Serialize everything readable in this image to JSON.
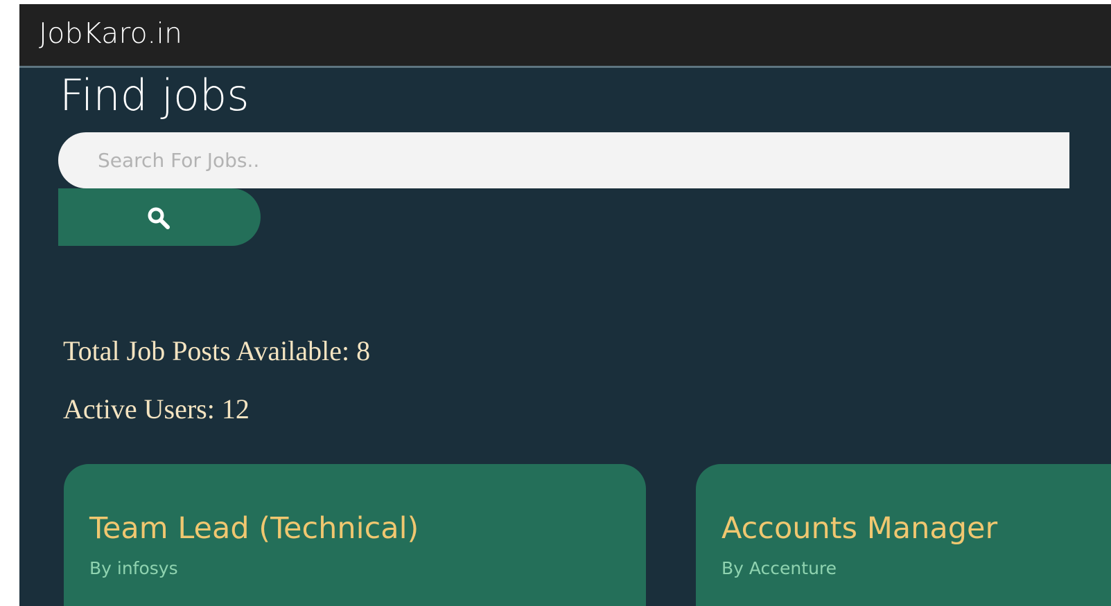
{
  "navbar": {
    "brand": "JobKaro.in"
  },
  "hero": {
    "title": "Find jobs"
  },
  "search": {
    "placeholder": "Search For Jobs..",
    "value": "",
    "button_icon": "search-icon"
  },
  "stats": {
    "total_posts": "Total Job Posts Available: 8",
    "active_users": "Active Users: 12"
  },
  "jobs": [
    {
      "title": "Team Lead (Technical)",
      "company": "By infosys"
    },
    {
      "title": "Accounts Manager",
      "company": "By Accenture"
    }
  ],
  "colors": {
    "navbar_bg": "#212121",
    "page_bg": "#1a2f3b",
    "accent_green": "#246f59",
    "job_title": "#f0c770",
    "company_text": "#8fd3b0",
    "stat_text": "#f4e4c1"
  }
}
